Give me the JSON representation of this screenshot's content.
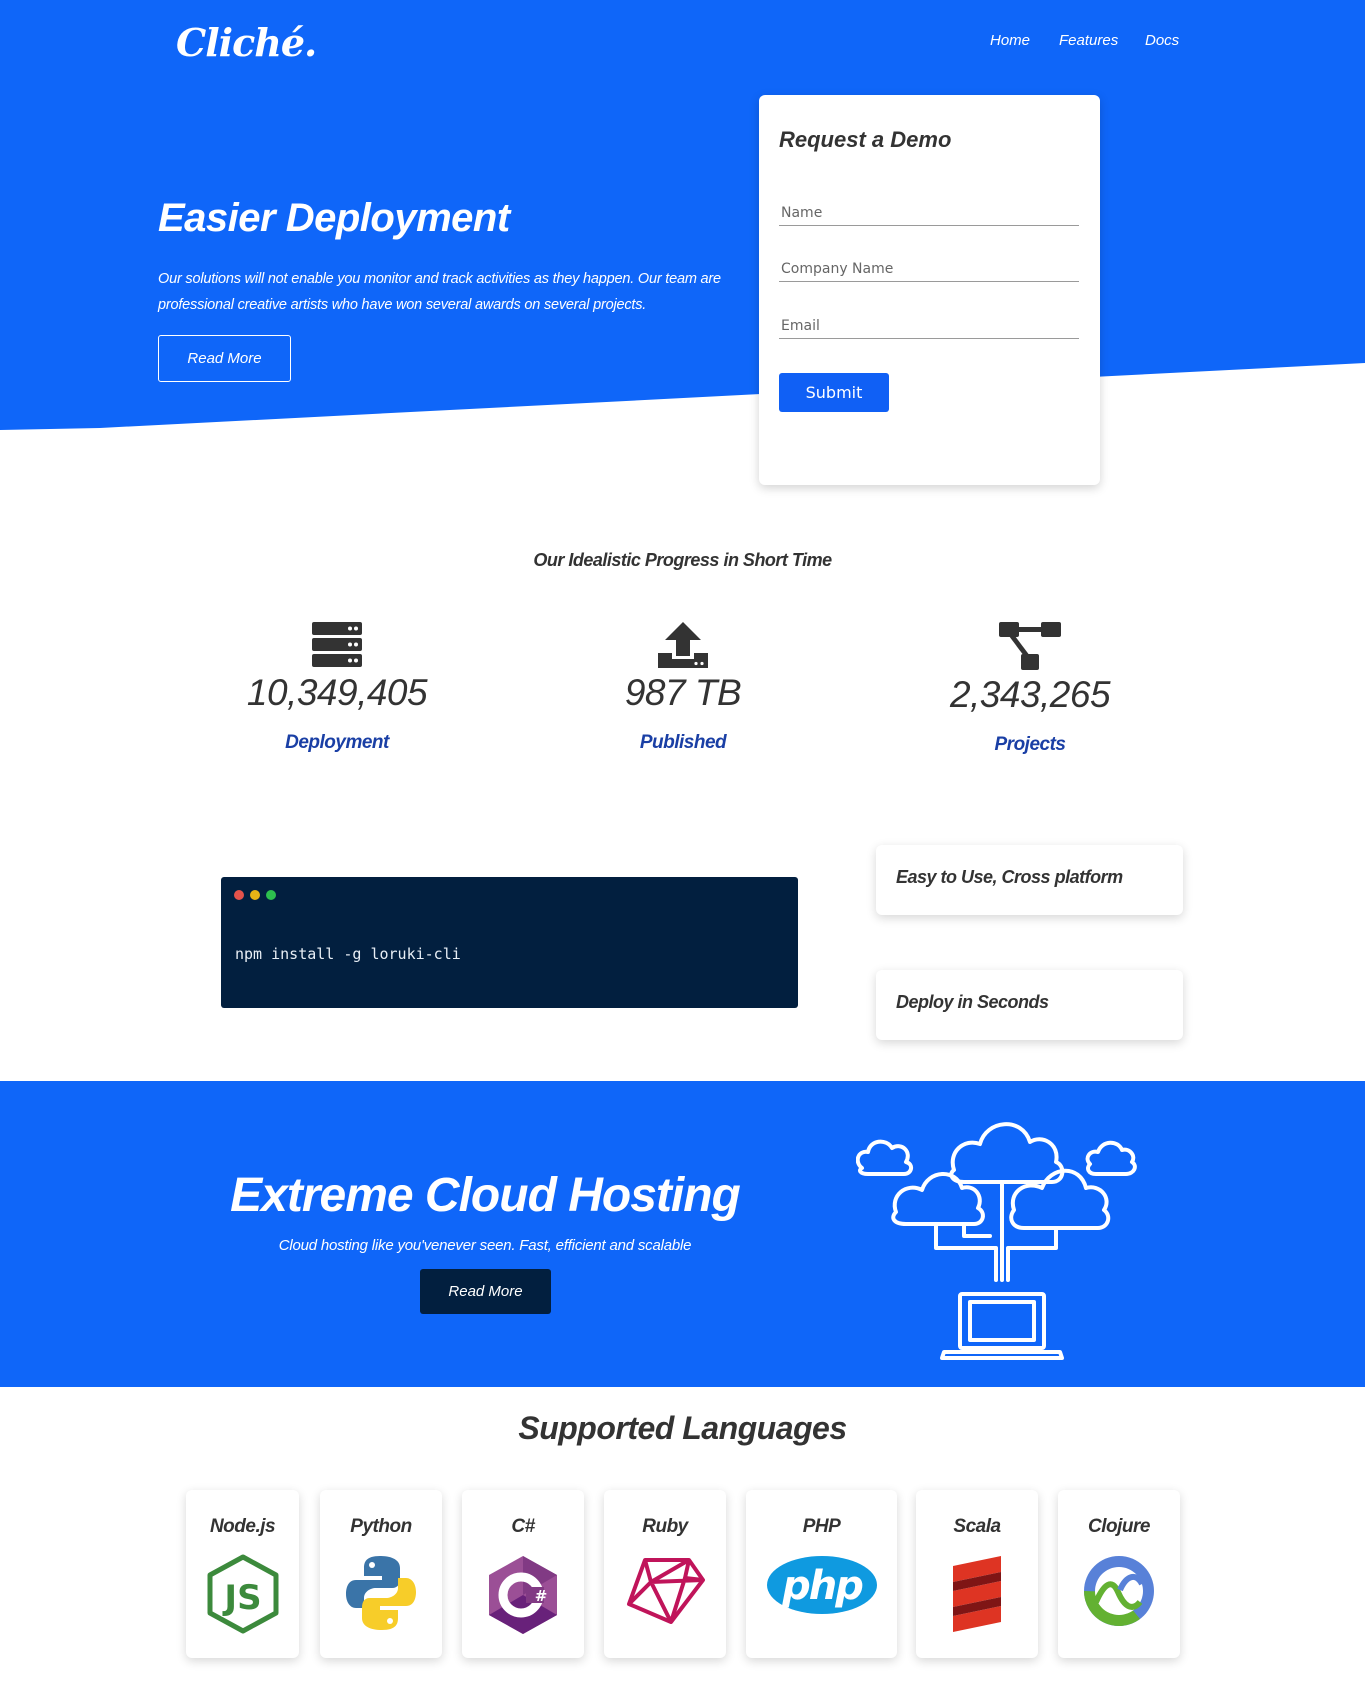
{
  "header": {
    "logo": "Cliché.",
    "nav": [
      "Home",
      "Features",
      "Docs"
    ]
  },
  "hero": {
    "title": "Easier Deployment",
    "text": "Our solutions will not enable you monitor and track activities as they happen. Our team are professional creative artists who have won several awards on several projects.",
    "button": "Read More"
  },
  "demo_form": {
    "title": "Request a Demo",
    "fields": [
      {
        "placeholder": "Name",
        "value": ""
      },
      {
        "placeholder": "Company Name",
        "value": ""
      },
      {
        "placeholder": "Email",
        "value": ""
      }
    ],
    "submit": "Submit"
  },
  "progress": {
    "title": "Our Idealistic Progress in Short Time",
    "stats": [
      {
        "icon": "server-icon",
        "value": "10,349,405",
        "label": "Deployment"
      },
      {
        "icon": "upload-icon",
        "value": "987 TB",
        "label": "Published"
      },
      {
        "icon": "sitemap-icon",
        "value": "2,343,265",
        "label": "Projects"
      }
    ]
  },
  "terminal": {
    "command": "npm install -g loruki-cli",
    "dot_colors": [
      "#e5534b",
      "#e7b416",
      "#2dbf4e"
    ]
  },
  "features": [
    "Easy to Use, Cross platform",
    "Deploy in Seconds"
  ],
  "cloud": {
    "title": "Extreme Cloud Hosting",
    "text": "Cloud hosting like you'venever seen. Fast, efficient and scalable",
    "button": "Read More"
  },
  "languages": {
    "title": "Supported Languages",
    "items": [
      {
        "name": "Node.js",
        "icon": "nodejs-icon"
      },
      {
        "name": "Python",
        "icon": "python-icon"
      },
      {
        "name": "C#",
        "icon": "csharp-icon"
      },
      {
        "name": "Ruby",
        "icon": "ruby-icon"
      },
      {
        "name": "PHP",
        "icon": "php-icon"
      },
      {
        "name": "Scala",
        "icon": "scala-icon"
      },
      {
        "name": "Clojure",
        "icon": "clojure-icon"
      }
    ]
  },
  "colors": {
    "primary": "#0f66f9",
    "dark": "#021f3f",
    "stat_label": "#1a3fa5"
  }
}
